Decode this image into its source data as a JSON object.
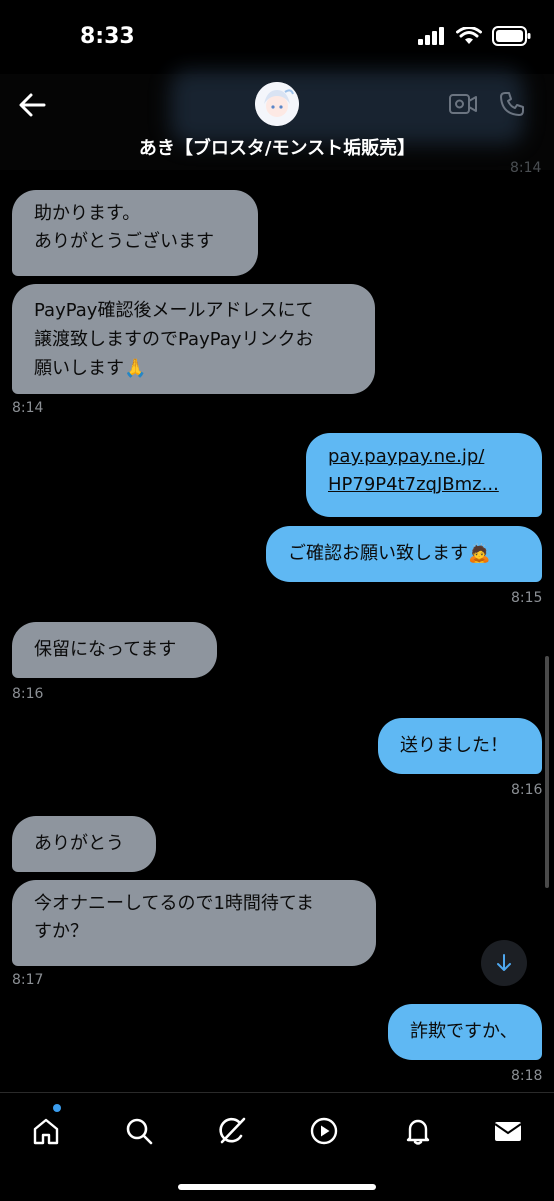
{
  "status_bar": {
    "time": "8:33"
  },
  "header": {
    "contact_name": "あき【ブロスタ/モンスト垢販売】"
  },
  "messages": [
    {
      "side": "received",
      "lines": [
        "助かります。",
        "ありがとうございます"
      ]
    },
    {
      "side": "received",
      "lines": [
        "PayPay確認後メールアドレスにて",
        "譲渡致しますのでPayPayリンクお",
        "願いします🙏"
      ],
      "time": "8:14"
    },
    {
      "side": "sent",
      "lines": [
        "pay.paypay.ne.jp/",
        "HP79P4t7zqJBmz..."
      ]
    },
    {
      "side": "sent",
      "lines": [
        "ご確認お願い致します🙇"
      ],
      "time": "8:15"
    },
    {
      "side": "received",
      "lines": [
        "保留になってます"
      ],
      "time": "8:16"
    },
    {
      "side": "sent",
      "lines": [
        "送りました！"
      ],
      "time": "8:16"
    },
    {
      "side": "received",
      "lines": [
        "ありがとう"
      ]
    },
    {
      "side": "received",
      "lines": [
        "今オナニーしてるので1時間待てま",
        "すか？"
      ],
      "time": "8:17"
    },
    {
      "side": "sent",
      "lines": [
        "詐欺ですか、"
      ],
      "time": "8:18"
    }
  ],
  "tabs": [
    {
      "name": "home",
      "icon": "home-icon"
    },
    {
      "name": "search",
      "icon": "search-icon"
    },
    {
      "name": "grok",
      "icon": "grok-icon"
    },
    {
      "name": "video",
      "icon": "play-icon"
    },
    {
      "name": "notifications",
      "icon": "bell-icon"
    },
    {
      "name": "messages",
      "icon": "mail-icon"
    }
  ],
  "colors": {
    "received_bubble": "#8e959e",
    "sent_bubble": "#5fb8f3",
    "accent": "#3b9dee"
  }
}
